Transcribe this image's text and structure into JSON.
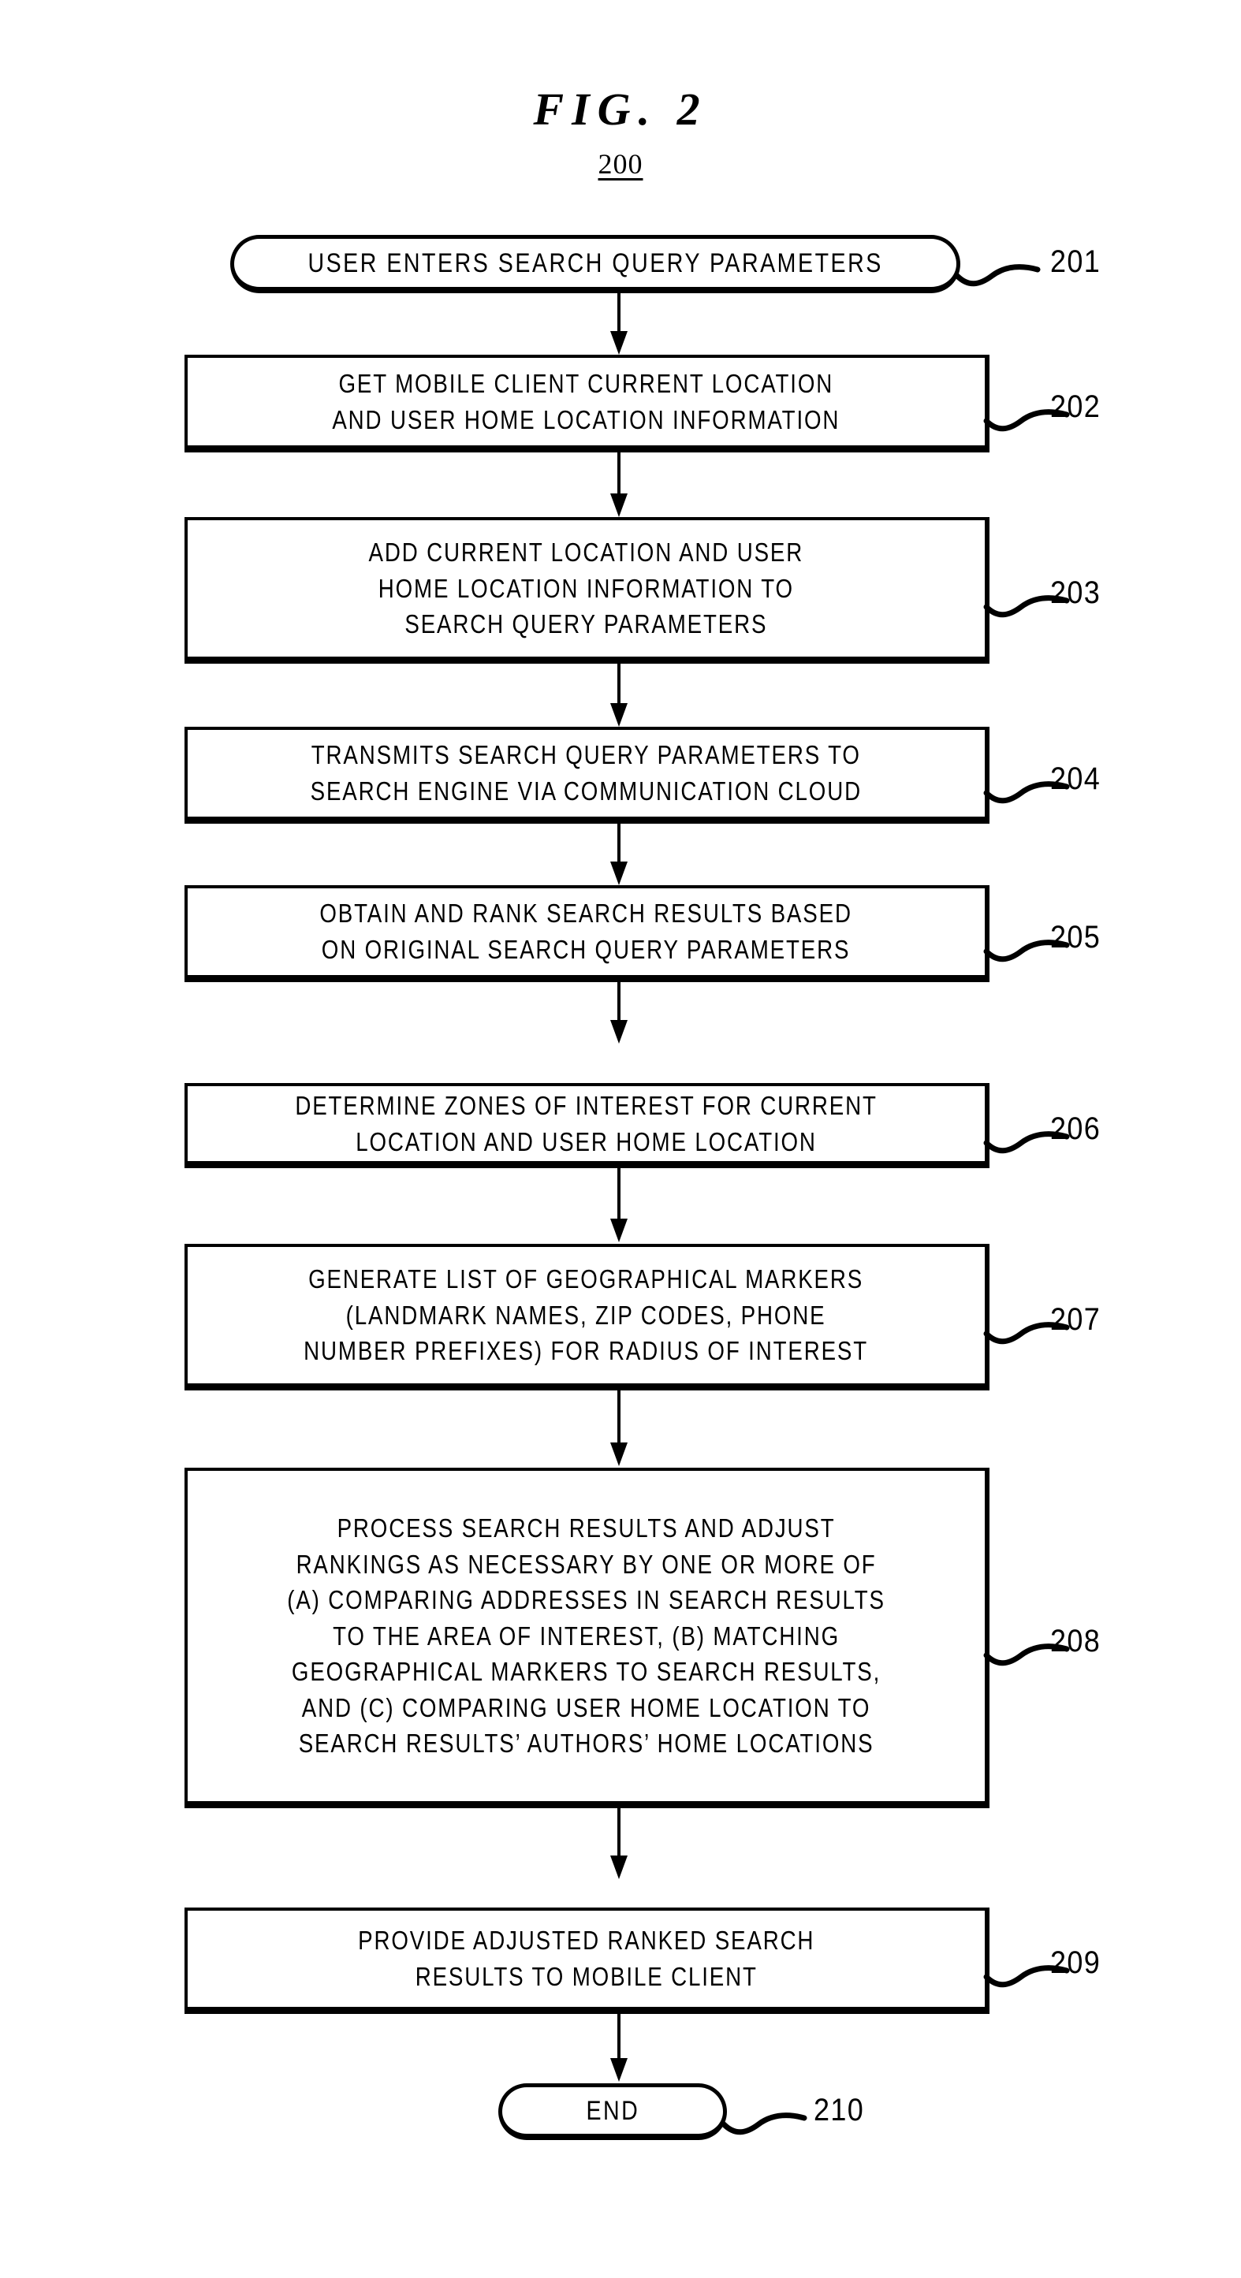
{
  "figure": {
    "title": "FIG.  2",
    "number": "200"
  },
  "flowchart": {
    "nodes": [
      {
        "ref": "201",
        "shape": "terminal",
        "lines": [
          "USER ENTERS SEARCH QUERY PARAMETERS"
        ]
      },
      {
        "ref": "202",
        "shape": "process",
        "lines": [
          "GET MOBILE CLIENT CURRENT LOCATION",
          "AND USER HOME LOCATION INFORMATION"
        ]
      },
      {
        "ref": "203",
        "shape": "process",
        "lines": [
          "ADD CURRENT LOCATION AND USER",
          "HOME LOCATION INFORMATION TO",
          "SEARCH QUERY PARAMETERS"
        ]
      },
      {
        "ref": "204",
        "shape": "process",
        "lines": [
          "TRANSMITS SEARCH QUERY PARAMETERS TO",
          "SEARCH ENGINE VIA COMMUNICATION CLOUD"
        ]
      },
      {
        "ref": "205",
        "shape": "process",
        "lines": [
          "OBTAIN AND RANK SEARCH RESULTS BASED",
          "ON ORIGINAL SEARCH QUERY PARAMETERS"
        ]
      },
      {
        "ref": "206",
        "shape": "process",
        "lines": [
          "DETERMINE ZONES OF INTEREST FOR CURRENT",
          "LOCATION AND USER HOME LOCATION"
        ]
      },
      {
        "ref": "207",
        "shape": "process",
        "lines": [
          "GENERATE LIST OF GEOGRAPHICAL MARKERS",
          "(LANDMARK NAMES, ZIP CODES, PHONE",
          "NUMBER PREFIXES) FOR RADIUS OF INTEREST"
        ]
      },
      {
        "ref": "208",
        "shape": "process",
        "lines": [
          "PROCESS SEARCH RESULTS AND ADJUST",
          "RANKINGS AS NECESSARY BY ONE OR MORE OF",
          "(A) COMPARING ADDRESSES IN SEARCH RESULTS",
          "TO THE AREA OF INTEREST, (B) MATCHING",
          "GEOGRAPHICAL MARKERS TO SEARCH RESULTS,",
          "AND (C) COMPARING USER HOME LOCATION TO",
          "SEARCH RESULTS’ AUTHORS’ HOME LOCATIONS"
        ]
      },
      {
        "ref": "209",
        "shape": "process",
        "lines": [
          "PROVIDE ADJUSTED RANKED SEARCH",
          "RESULTS TO MOBILE CLIENT"
        ]
      },
      {
        "ref": "210",
        "shape": "terminal",
        "lines": [
          "END"
        ]
      }
    ]
  },
  "style": {
    "ink": "#000000",
    "paper": "#ffffff"
  }
}
